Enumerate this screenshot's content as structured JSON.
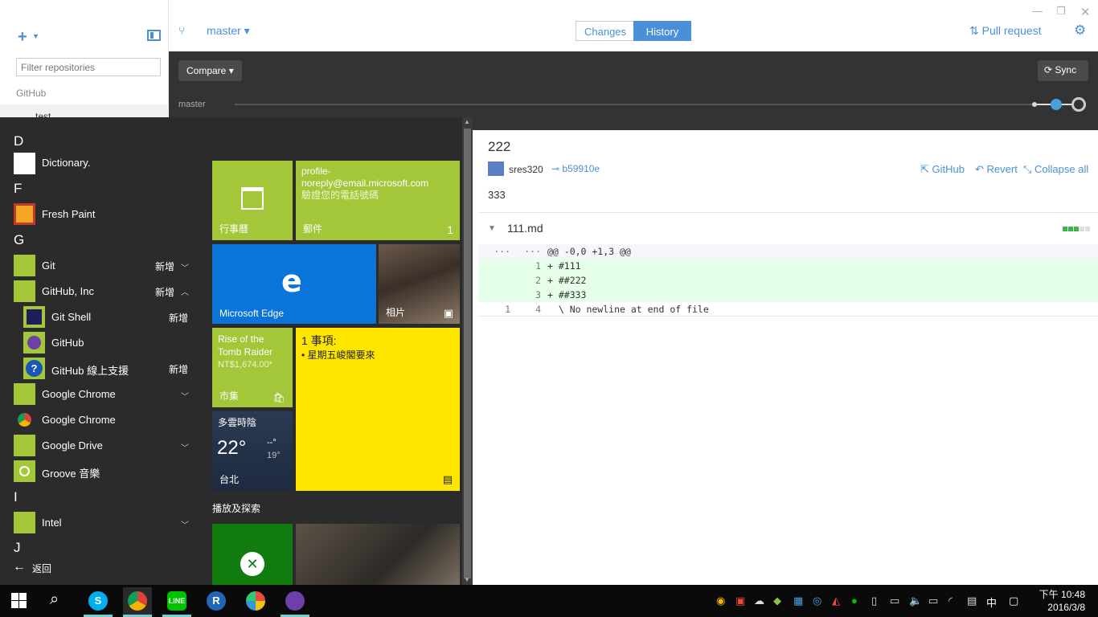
{
  "sidebar": {
    "filter_placeholder": "Filter repositories",
    "section": "GitHub",
    "repo": "test"
  },
  "header": {
    "branch": "master ▾",
    "tabs": [
      {
        "label": "Changes"
      },
      {
        "label": "History"
      }
    ],
    "pull_request": "Pull request"
  },
  "toolbar": {
    "compare": "Compare ▾",
    "sync": "Sync",
    "timeline_branch": "master"
  },
  "commit": {
    "title": "222",
    "author": "sres320",
    "sha": "b59910e",
    "github_link": "GitHub",
    "revert": "Revert",
    "collapse_all": "Collapse all",
    "description": "333",
    "file": "111.md"
  },
  "diff": [
    {
      "old": "···",
      "new": "···",
      "code": "@@ -0,0 +1,3 @@",
      "type": "hunk"
    },
    {
      "old": "",
      "new": "1",
      "code": "+ #111",
      "type": "add"
    },
    {
      "old": "",
      "new": "2",
      "code": "+ ##222",
      "type": "add"
    },
    {
      "old": "",
      "new": "3",
      "code": "+ ##333",
      "type": "add"
    },
    {
      "old": "1",
      "new": "4",
      "code": "  \\ No newline at end of file",
      "type": "context"
    }
  ],
  "start_menu": {
    "letters": [
      "D",
      "F",
      "G",
      "I",
      "J"
    ],
    "items": [
      {
        "label": "Dictionary.",
        "badge": ""
      },
      {
        "label": "Fresh Paint",
        "badge": ""
      },
      {
        "label": "Git",
        "badge": "新增"
      },
      {
        "label": "GitHub, Inc",
        "badge": "新增"
      },
      {
        "label": "Git Shell",
        "badge": "新增"
      },
      {
        "label": "GitHub",
        "badge": ""
      },
      {
        "label": "GitHub 線上支援",
        "badge": "新增"
      },
      {
        "label": "Google Chrome",
        "badge": ""
      },
      {
        "label": "Google Chrome",
        "badge": ""
      },
      {
        "label": "Google Drive",
        "badge": ""
      },
      {
        "label": "Groove 音樂",
        "badge": ""
      },
      {
        "label": "Intel",
        "badge": ""
      }
    ],
    "back": "返回",
    "tiles": {
      "calendar": "行事曆",
      "mail_line1": "profile-",
      "mail_line2": "noreply@email.microsoft.com",
      "mail_line3": "驗證您的電話號碼",
      "mail_label": "郵件",
      "mail_count": "1",
      "edge": "Microsoft Edge",
      "photos": "相片",
      "store_title_1": "Rise of the",
      "store_title_2": "Tomb Raider",
      "store_price": "NT$1,674.00*",
      "store": "市集",
      "todo_title": "1 事項:",
      "todo_item": "• 星期五峻閣要來",
      "weather_title": "多雲時陰",
      "weather_temp": "22°",
      "weather_hi": "--°",
      "weather_lo": "19°",
      "weather_city": "台北",
      "group2": "播放及探索"
    }
  },
  "taskbar": {
    "ime": "中",
    "time": "下午 10:48",
    "date": "2016/3/8"
  },
  "colors": {
    "accent": "#4a90d9",
    "tile_green": "#a4c639",
    "edge_blue": "#0a74d9",
    "todo_yellow": "#ffe600"
  }
}
